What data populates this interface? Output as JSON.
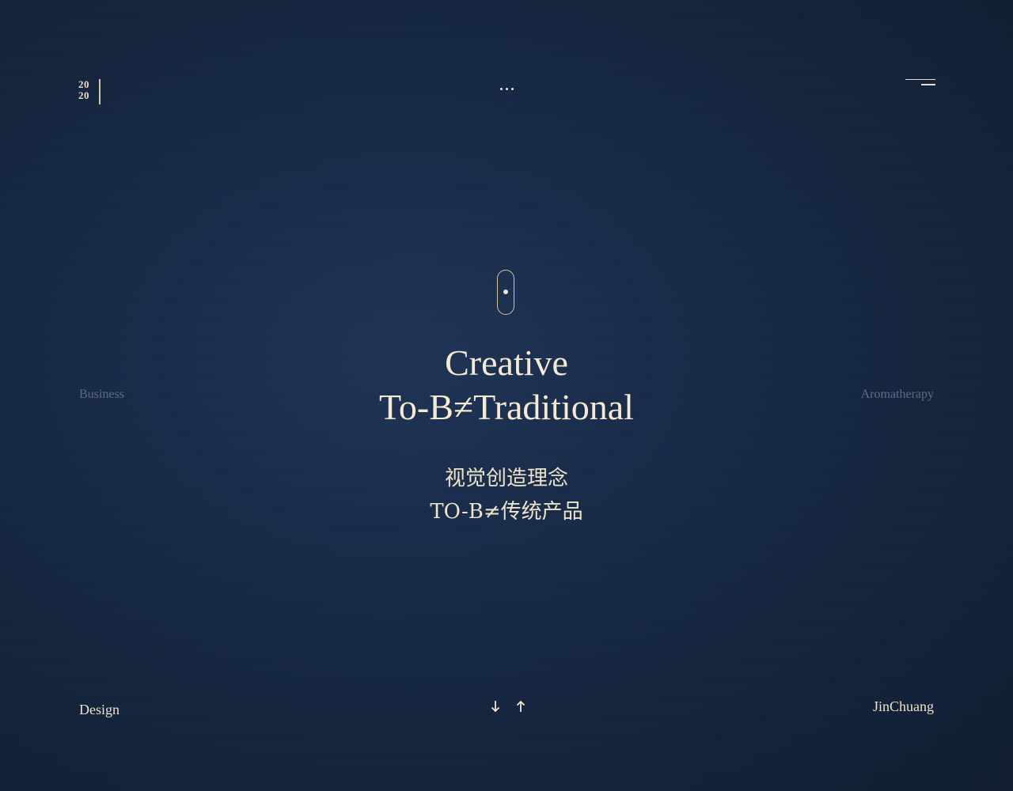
{
  "header": {
    "logo_year_top": "20",
    "logo_year_bottom": "20",
    "more_icon": "more-dots-icon",
    "menu_icon": "menu-icon"
  },
  "side": {
    "left_label": "Business",
    "right_label": "Aromatherapy"
  },
  "hero": {
    "scroll_icon": "scroll-mouse-icon",
    "title_line1": "Creative",
    "title_line2": "To-B≠Traditional",
    "subtitle_line1": "视觉创造理念",
    "subtitle_line2": "TO-B≠传统产品"
  },
  "footer": {
    "left_label": "Design",
    "right_label": "JinChuang",
    "down_icon": "arrow-down-icon",
    "up_icon": "arrow-up-icon"
  },
  "colors": {
    "background": "#172a47",
    "accent_gold": "#d7c39a",
    "text_cream": "#f5ead2",
    "muted_label": "#5d6c83"
  }
}
